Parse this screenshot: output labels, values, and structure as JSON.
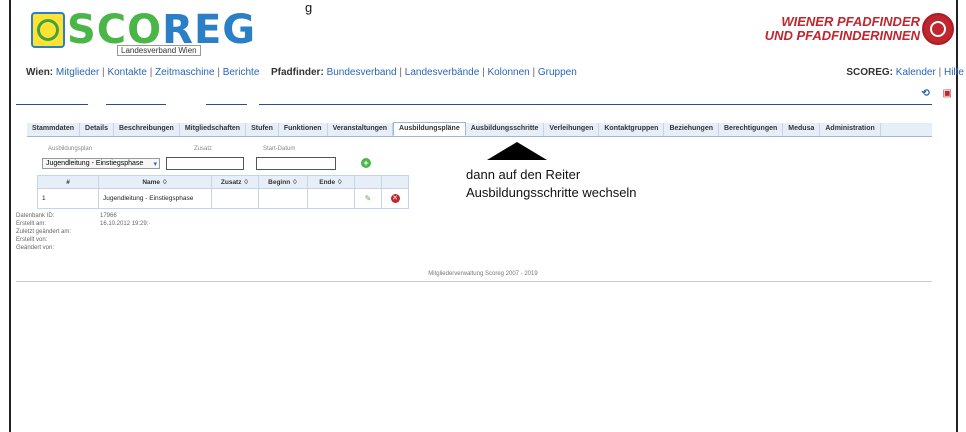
{
  "caption_top": "g",
  "logo": {
    "wordmark_a": "SCO",
    "wordmark_b": "REG",
    "subtag": "Landesverband Wien"
  },
  "brand": {
    "line1": "WIENER PFADFINDER",
    "line2": "UND PFADFINDERINNEN"
  },
  "nav": {
    "wien_label": "Wien:",
    "wien_links": [
      "Mitglieder",
      "Kontakte",
      "Zeitmaschine",
      "Berichte"
    ],
    "pfad_label": "Pfadfinder:",
    "pfad_links": [
      "Bundesverband",
      "Landesverbände",
      "Kolonnen",
      "Gruppen"
    ],
    "scoreg_label": "SCOREG:",
    "scoreg_links": [
      "Kalender",
      "Hilfe"
    ]
  },
  "tabs": [
    "Stammdaten",
    "Details",
    "Beschreibungen",
    "Mitgliedschaften",
    "Stufen",
    "Funktionen",
    "Veranstaltungen",
    "Ausbildungspläne",
    "Ausbildungsschritte",
    "Verleihungen",
    "Kontaktgruppen",
    "Beziehungen",
    "Berechtigungen",
    "Medusa",
    "Administration"
  ],
  "active_tab": "Ausbildungspläne",
  "form": {
    "plan_label": "Ausbildungsplan",
    "plan_value": "Jugendleitung - Einstiegsphase",
    "zusatz_label": "Zusatz",
    "start_label": "Start-Datum"
  },
  "grid": {
    "headers": [
      "#",
      "Name ♢",
      "Zusatz ♢",
      "Beginn ♢",
      "Ende ♢",
      "",
      ""
    ],
    "rows": [
      {
        "num": "1",
        "name": "Jugendleitung - Einstiegsphase",
        "zusatz": "",
        "beginn": "",
        "ende": ""
      }
    ]
  },
  "annotation": {
    "line1": "dann auf den Reiter",
    "line2": "Ausbildungsschritte wechseln"
  },
  "meta": [
    {
      "k": "Datenbank ID:",
      "v": "17966"
    },
    {
      "k": "Erstellt am:",
      "v": "16.10.2012 19:29:·"
    },
    {
      "k": "Zuletzt geändert am:",
      "v": ""
    },
    {
      "k": "Erstellt von:",
      "v": ""
    },
    {
      "k": "Geändert von:",
      "v": ""
    }
  ],
  "footer": "Mitgliederverwaltung Scoreg 2007 - 2019"
}
